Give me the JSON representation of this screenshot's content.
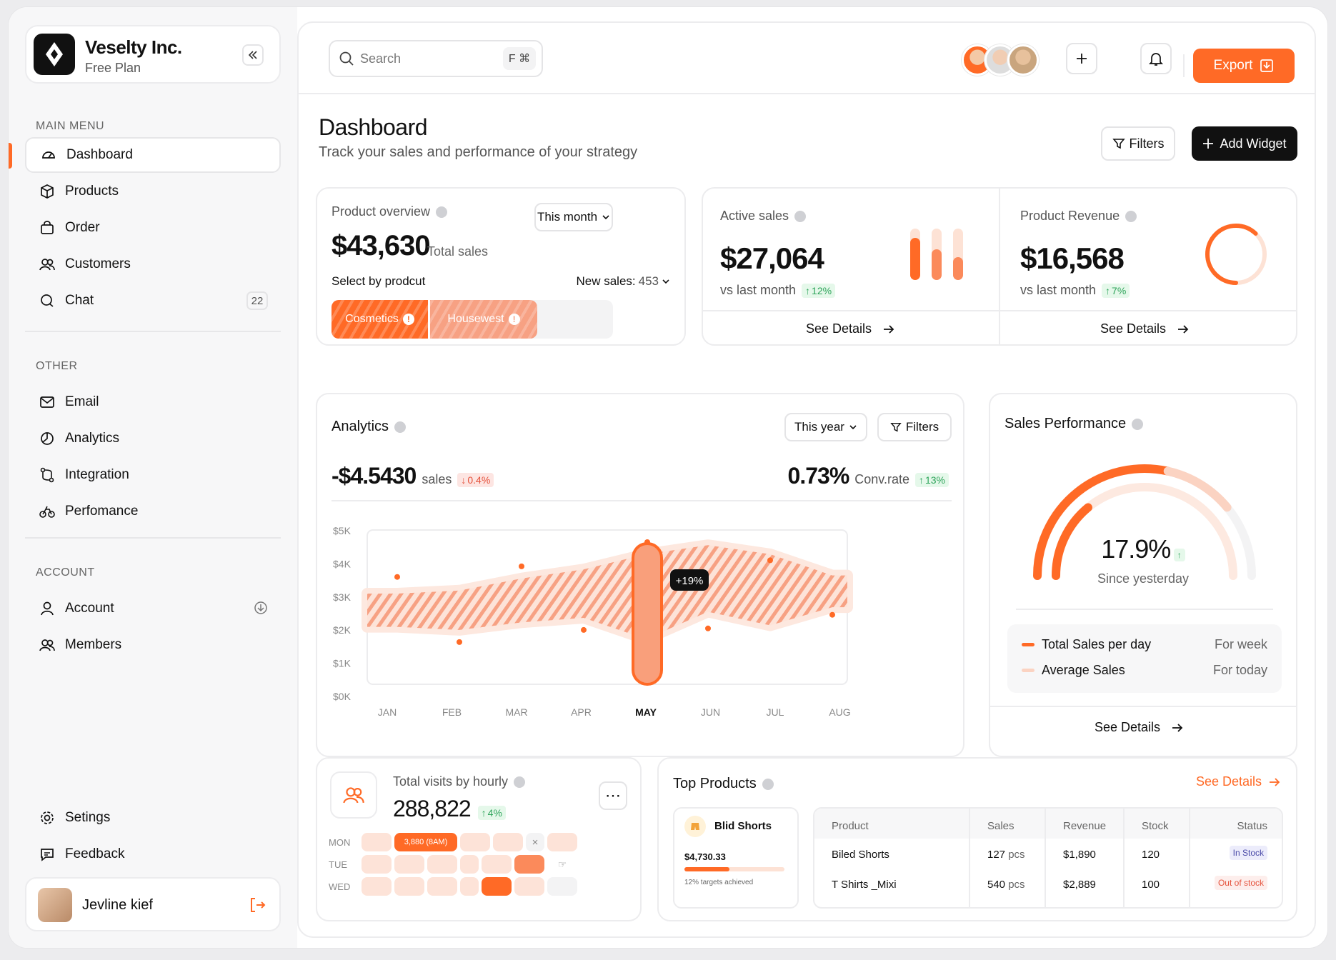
{
  "brand": {
    "name": "Veselty Inc.",
    "plan": "Free Plan"
  },
  "sidebar": {
    "main_label": "MAIN MENU",
    "main_items": [
      {
        "label": "Dashboard",
        "icon": "dashboard-icon"
      },
      {
        "label": "Products",
        "icon": "box-icon"
      },
      {
        "label": "Order",
        "icon": "bag-icon"
      },
      {
        "label": "Customers",
        "icon": "users-icon"
      },
      {
        "label": "Chat",
        "icon": "chat-icon",
        "badge": "22"
      }
    ],
    "other_label": "OTHER",
    "other_items": [
      {
        "label": "Email",
        "icon": "mail-icon"
      },
      {
        "label": "Analytics",
        "icon": "pie-icon"
      },
      {
        "label": "Integration",
        "icon": "integration-icon"
      },
      {
        "label": "Perfomance",
        "icon": "bike-icon"
      }
    ],
    "account_label": "ACCOUNT",
    "account_items": [
      {
        "label": "Account",
        "icon": "user-icon"
      },
      {
        "label": "Members",
        "icon": "members-icon"
      }
    ],
    "bottom_items": [
      {
        "label": "Setings",
        "icon": "gear-icon"
      },
      {
        "label": "Feedback",
        "icon": "feedback-icon"
      }
    ],
    "user": {
      "name": "Jevline kief"
    }
  },
  "topbar": {
    "search_placeholder": "Search",
    "shortcut": "F ⌘",
    "export_label": "Export"
  },
  "header": {
    "title": "Dashboard",
    "subtitle": "Track your sales and performance of your strategy",
    "filters_label": "Filters",
    "add_widget_label": "Add Widget"
  },
  "product_overview": {
    "label": "Product overview",
    "period": "This month",
    "value": "$43,630",
    "value_caption": "Total sales",
    "select_label": "Select by prodcut",
    "new_sales_label": "New sales:",
    "new_sales_value": "453",
    "segments": [
      {
        "label": "Cosmetics",
        "share": 0.35
      },
      {
        "label": "Housewest",
        "share": 0.38
      }
    ]
  },
  "active_sales": {
    "label": "Active sales",
    "value": "$27,064",
    "compare": "vs last month",
    "change": "12%",
    "see_details": "See Details",
    "bars": [
      0.82,
      0.6,
      0.45
    ]
  },
  "product_revenue": {
    "label": "Product Revenue",
    "value": "$16,568",
    "compare": "vs last month",
    "change": "7%",
    "see_details": "See Details",
    "ring_fill": 0.62
  },
  "analytics": {
    "label": "Analytics",
    "period": "This year",
    "filters_label": "Filters",
    "sales_value": "-$4.5430",
    "sales_caption": "sales",
    "sales_change": "0.4%",
    "conv_value": "0.73%",
    "conv_caption": "Conv.rate",
    "conv_change": "13%",
    "tooltip": "+19%",
    "highlight_month": "MAY"
  },
  "chart_data": {
    "type": "area",
    "categories": [
      "JAN",
      "FEB",
      "MAR",
      "APR",
      "MAY",
      "JUN",
      "JUL",
      "AUG"
    ],
    "y_ticks": [
      "$5K",
      "$4K",
      "$3K",
      "$2K",
      "$1K",
      "$0K"
    ],
    "ylim": [
      0,
      5000
    ],
    "series": [
      {
        "values": [
          3450,
          1300,
          3800,
          1700,
          4600,
          1750,
          4000,
          2200
        ]
      }
    ],
    "band_upper": [
      2900,
      3000,
      3400,
      3700,
      4200,
      4500,
      4200,
      3500
    ],
    "band_lower": [
      1800,
      1700,
      1950,
      2100,
      1400,
      2300,
      1850,
      2450
    ]
  },
  "sales_performance": {
    "label": "Sales Performance",
    "value": "17.9%",
    "caption": "Since yesterday",
    "outer_fill": 0.57,
    "inner_fill": 0.28,
    "legend": [
      {
        "label": "Total Sales per day",
        "period": "For week",
        "color": "#ff6a26"
      },
      {
        "label": "Average Sales",
        "period": "For today",
        "color": "#fbd3c2"
      }
    ],
    "see_details": "See Details"
  },
  "visits": {
    "label": "Total visits by hourly",
    "value": "288,822",
    "change": "4%",
    "days": [
      "MON",
      "TUE",
      "WED"
    ],
    "tag": "3,880 (8AM)"
  },
  "top_products": {
    "label": "Top Products",
    "see_details": "See Details",
    "featured": {
      "name": "Blid Shorts",
      "amount": "$4,730.33",
      "progress": 0.45,
      "caption": "12% targets achieved"
    },
    "columns": [
      "Product",
      "Sales",
      "Revenue",
      "Stock",
      "Status"
    ],
    "rows": [
      {
        "product": "Biled Shorts",
        "sales": "127",
        "unit": "pcs",
        "revenue": "$1,890",
        "stock": "120",
        "status": "In Stock"
      },
      {
        "product": "T Shirts _Mixi",
        "sales": "540",
        "unit": "pcs",
        "revenue": "$2,889",
        "stock": "100",
        "status": "Out of stock"
      }
    ]
  },
  "colors": {
    "accent": "#ff6a26",
    "accent_light": "#fbd3c2",
    "dark": "#111111",
    "up": "#2fa45b",
    "down": "#e5533d"
  }
}
